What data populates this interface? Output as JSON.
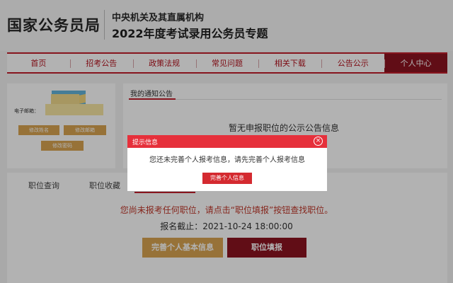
{
  "header": {
    "logo": "国家公务员局",
    "subtitle_1": "中央机关及其直属机构",
    "subtitle_2": "2022年度考试录用公务员专题"
  },
  "nav": {
    "items": [
      "首页",
      "招考公告",
      "政策法规",
      "常见问题",
      "相关下载",
      "公告公示",
      "个人中心"
    ],
    "active": "个人中心"
  },
  "profile": {
    "email_label": "电子邮箱：",
    "buttons": {
      "edit_name": "修改姓名",
      "edit_email": "修改邮箱",
      "edit_password": "修改密码"
    }
  },
  "notice": {
    "title": "我的通知公告",
    "empty_text": "暂无申报职位的公示公告信息"
  },
  "bottom": {
    "tabs": [
      "职位查询",
      "职位收藏"
    ],
    "warning": "您尚未报考任何职位，请点击“职位填报”按钮查找职位。",
    "deadline": "报名截止：2021-10-24 18:00:00",
    "complete_button": "完善个人基本信息",
    "fill_button": "职位填报"
  },
  "modal": {
    "title": "提示信息",
    "close_glyph": "×",
    "message": "您还未完善个人报考信息，请先完善个人报考信息",
    "button": "完善个人信息"
  },
  "colors": {
    "brand_red": "#c21f2b",
    "dark_red": "#8c1420",
    "gold": "#d9a451",
    "modal_red": "#e6303b"
  }
}
